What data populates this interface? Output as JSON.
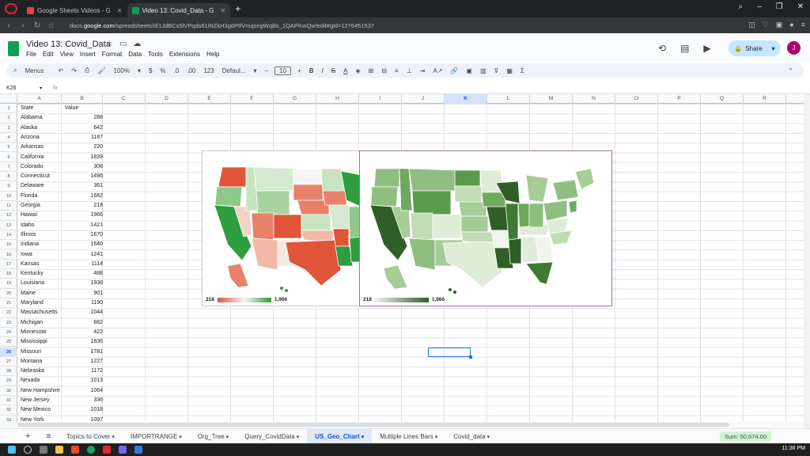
{
  "browser": {
    "tabs": [
      {
        "label": "Google Sheets Videos - G",
        "color": "#ea4335"
      },
      {
        "label": "Video 13: Covid_Data - G",
        "color": "#0f9d58",
        "active": true
      }
    ],
    "url_prefix": "docs.",
    "url_domain": "google.com",
    "url_rest": "/spreadsheets/d/1JdBCs5lVPqds61iNZkH3g6P8VmqsegWqBs_1QAPKwQw/edit#gid=1276451537"
  },
  "doc": {
    "title": "Video 13: Covid_Data",
    "menus": [
      "File",
      "Edit",
      "View",
      "Insert",
      "Format",
      "Data",
      "Tools",
      "Extensions",
      "Help"
    ],
    "share_label": "Share",
    "avatar_letter": "J"
  },
  "toolbar": {
    "search_label": "Menus",
    "zoom": "100%",
    "currency": "$",
    "percent": "%",
    "dec_dec": ".0",
    "inc_dec": ".00",
    "num_format": "123",
    "font": "Defaul...",
    "font_size": "10"
  },
  "formula_bar": {
    "cell_ref": "K26",
    "fx": "fx",
    "content": ""
  },
  "columns": [
    "A",
    "B",
    "C",
    "D",
    "E",
    "F",
    "G",
    "H",
    "I",
    "J",
    "K",
    "L",
    "M",
    "N",
    "O",
    "P",
    "Q",
    "R"
  ],
  "selected_column": "K",
  "selected_row": "26",
  "header_row": {
    "a": "State",
    "b": "Value"
  },
  "rows": [
    {
      "state": "Alabama",
      "value": "288"
    },
    {
      "state": "Alaska",
      "value": "642"
    },
    {
      "state": "Arizona",
      "value": "1187"
    },
    {
      "state": "Arkansas",
      "value": "220"
    },
    {
      "state": "California",
      "value": "1839"
    },
    {
      "state": "Colorado",
      "value": "308"
    },
    {
      "state": "Connecticut",
      "value": "1496"
    },
    {
      "state": "Delaware",
      "value": "361"
    },
    {
      "state": "Florida",
      "value": "1682"
    },
    {
      "state": "Georgia",
      "value": "218"
    },
    {
      "state": "Hawaii",
      "value": "1966"
    },
    {
      "state": "Idaho",
      "value": "1421"
    },
    {
      "state": "Illinois",
      "value": "1670"
    },
    {
      "state": "Indiana",
      "value": "1540"
    },
    {
      "state": "Iowa",
      "value": "1241"
    },
    {
      "state": "Kansas",
      "value": "1114"
    },
    {
      "state": "Kentucky",
      "value": "488"
    },
    {
      "state": "Louisiana",
      "value": "1938"
    },
    {
      "state": "Maine",
      "value": "901"
    },
    {
      "state": "Maryland",
      "value": "1190"
    },
    {
      "state": "Massachusetts",
      "value": "1044"
    },
    {
      "state": "Michigan",
      "value": "882"
    },
    {
      "state": "Minnesota",
      "value": "422"
    },
    {
      "state": "Mississippi",
      "value": "1836"
    },
    {
      "state": "Missouri",
      "value": "1781"
    },
    {
      "state": "Montana",
      "value": "1227"
    },
    {
      "state": "Nebraska",
      "value": "1172"
    },
    {
      "state": "Nevada",
      "value": "1013"
    },
    {
      "state": "New Hampshire",
      "value": "1064"
    },
    {
      "state": "New Jersey",
      "value": "336"
    },
    {
      "state": "New Mexico",
      "value": "1018"
    },
    {
      "state": "New York",
      "value": "1097"
    }
  ],
  "charts": [
    {
      "min_label": "218",
      "max_label": "1,966",
      "low_color": "#e0553a",
      "mid_color": "#f5f5f5",
      "high_color": "#2e9e3e"
    },
    {
      "min_label": "218",
      "max_label": "1,966",
      "low_color": "#f0f5ec",
      "high_color": "#2f5f26"
    }
  ],
  "sheet_tabs": [
    {
      "label": "Topics to Cover"
    },
    {
      "label": "IMPORTRANGE"
    },
    {
      "label": "Org_Tree"
    },
    {
      "label": "Query_CovidData"
    },
    {
      "label": "US_Geo_Chart",
      "active": true
    },
    {
      "label": "Multiple Lines Bars"
    },
    {
      "label": "Covid_data"
    }
  ],
  "status": {
    "sum": "Sum: 50,674.00"
  },
  "taskbar": {
    "time": "11:36 PM"
  }
}
